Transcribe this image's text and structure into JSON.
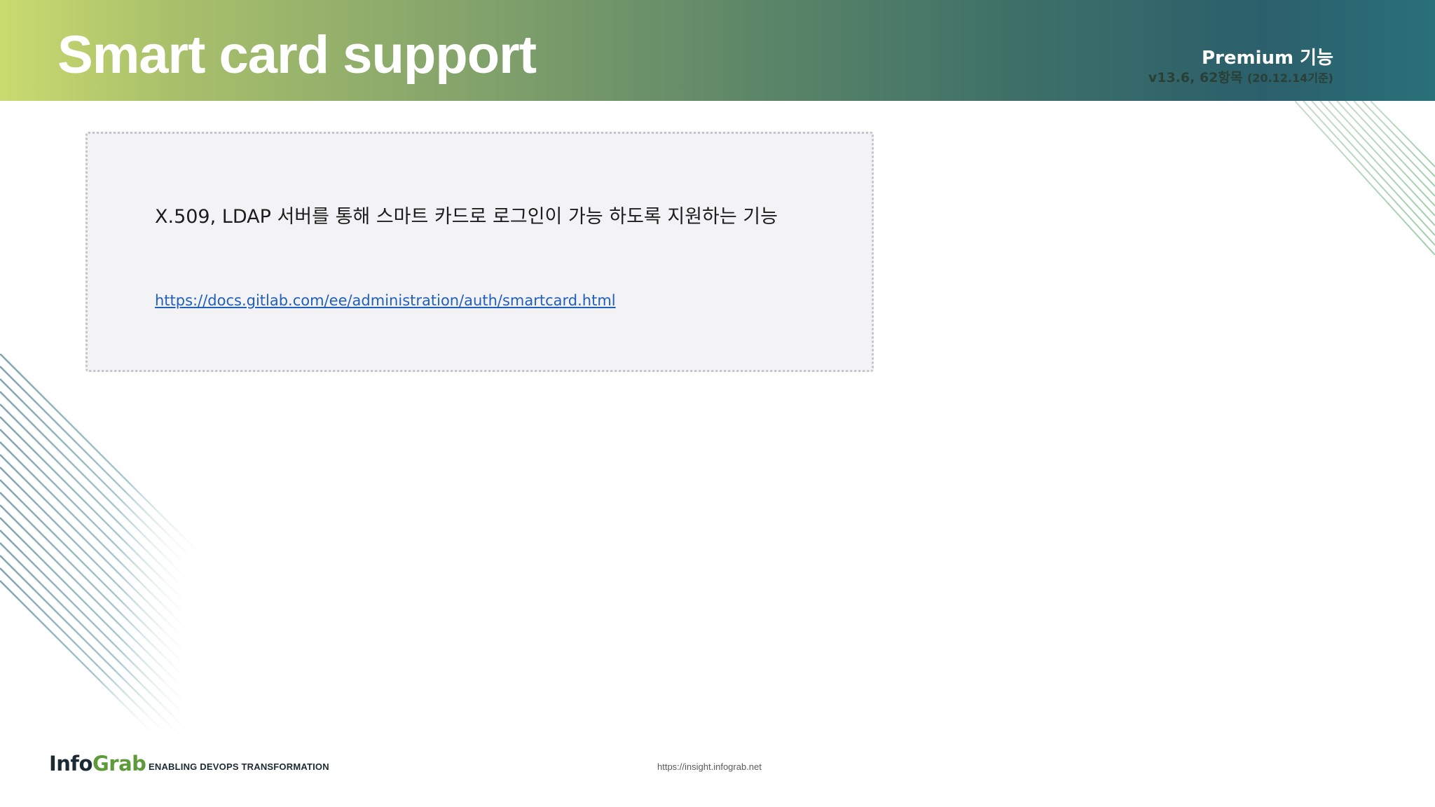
{
  "header": {
    "title": "Smart card support",
    "tier": "Premium 기능",
    "version": "v13.6, 62항목",
    "version_date": "(20.12.14기준)"
  },
  "card": {
    "description": "X.509, LDAP 서버를 통해 스마트 카드로 로그인이 가능 하도록 지원하는 기능",
    "link": "https://docs.gitlab.com/ee/administration/auth/smartcard.html"
  },
  "footer": {
    "logo_info": "Info",
    "logo_grab": "Grab",
    "tagline": "ENABLING DEVOPS TRANSFORMATION",
    "url": "https://insight.infograb.net"
  },
  "colors": {
    "header_start": "#c9da6f",
    "header_end": "#2a7079",
    "card_background": "#f3f2f4",
    "link": "#1f5fbf",
    "logo_green": "#5f9a3a"
  }
}
